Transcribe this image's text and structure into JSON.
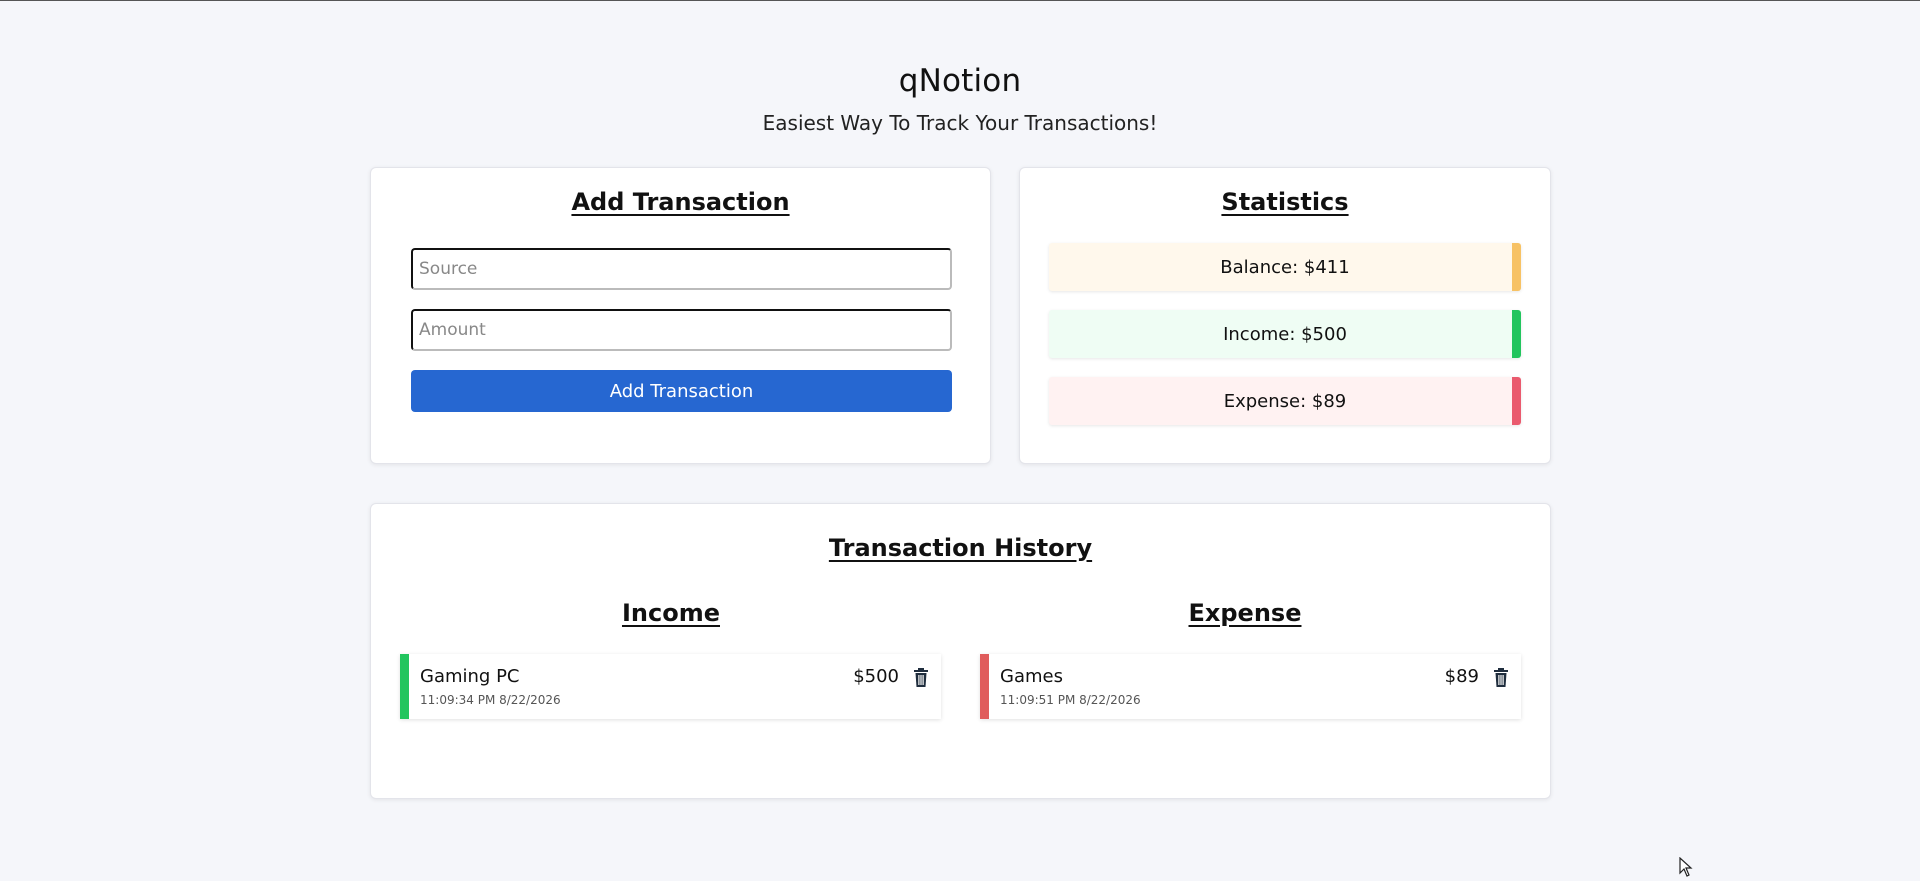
{
  "header": {
    "title": "qNotion",
    "subtitle": "Easiest Way To Track Your Transactions!"
  },
  "add_transaction": {
    "title": "Add Transaction",
    "source_placeholder": "Source",
    "amount_placeholder": "Amount",
    "button_label": "Add Transaction"
  },
  "statistics": {
    "title": "Statistics",
    "balance": "Balance: $411",
    "income": "Income: $500",
    "expense": "Expense: $89",
    "colors": {
      "balance": "#f7c265",
      "income": "#22c55e",
      "expense": "#ea5a6e"
    }
  },
  "history": {
    "title": "Transaction History",
    "income_title": "Income",
    "expense_title": "Expense",
    "income_items": [
      {
        "source": "Gaming PC",
        "time": "11:09:34 PM 8/22/2026",
        "amount": "$500"
      }
    ],
    "expense_items": [
      {
        "source": "Games",
        "time": "11:09:51 PM 8/22/2026",
        "amount": "$89"
      }
    ],
    "colors": {
      "income": "#22c55e",
      "expense": "#e05c5c"
    }
  }
}
